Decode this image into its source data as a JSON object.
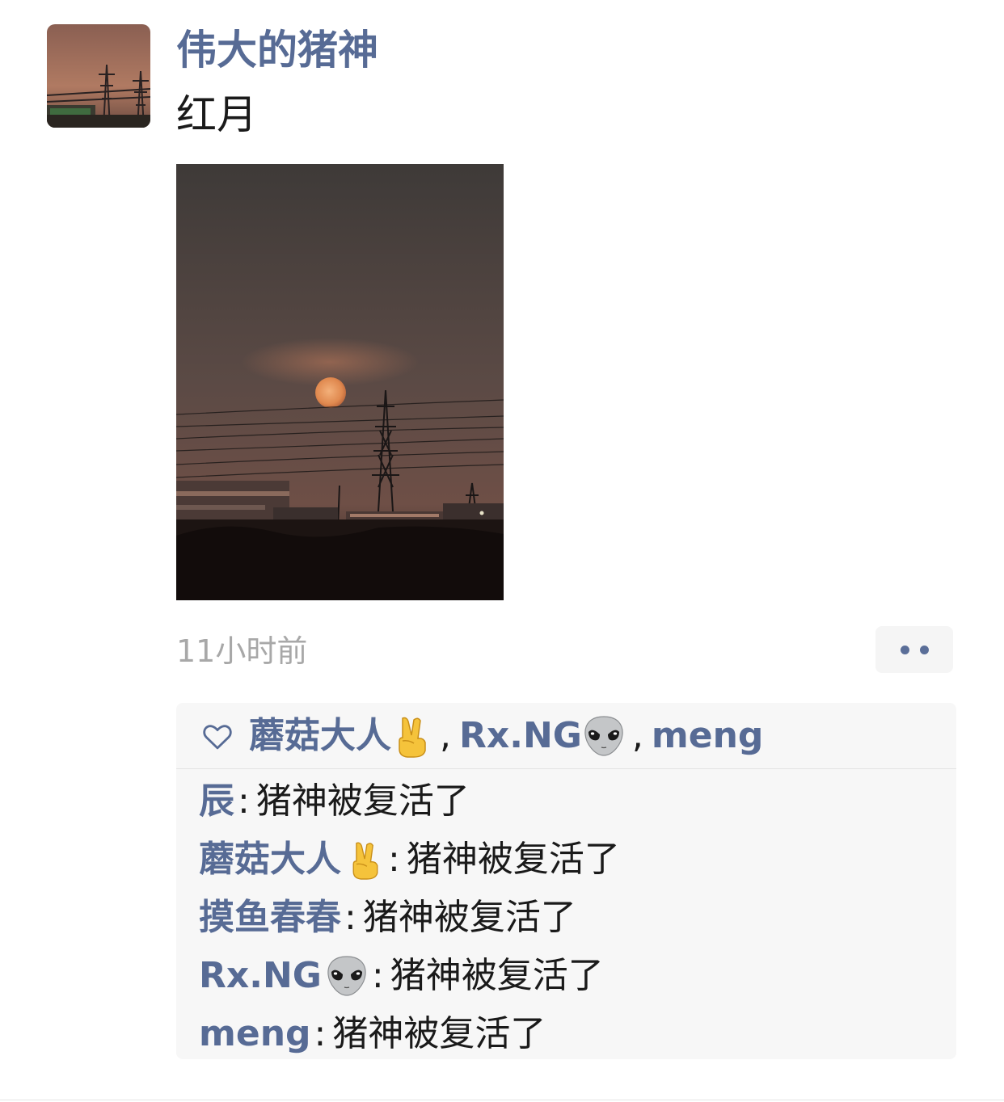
{
  "post": {
    "author": "伟大的猪神",
    "text": "红月",
    "time": "11小时前"
  },
  "icons": {
    "avatar": "avatar-image",
    "photo": "red-moon-photo",
    "more": "more-dots-icon",
    "like": "heart-outline-icon",
    "emoji_victory": "victory-hand-emoji",
    "emoji_alien": "alien-emoji"
  },
  "likes": {
    "separator": ",",
    "users": [
      "蘑菇大人",
      "Rx.NG",
      "meng"
    ]
  },
  "comments": {
    "colon": ":",
    "items": [
      {
        "author": "辰",
        "text": "猪神被复活了"
      },
      {
        "author": "蘑菇大人",
        "text": "猪神被复活了"
      },
      {
        "author": "摸鱼春春",
        "text": "猪神被复活了"
      },
      {
        "author": "Rx.NG",
        "text": "猪神被复活了"
      },
      {
        "author": "meng",
        "text": "猪神被复活了"
      }
    ]
  },
  "colors": {
    "name_blue": "#576b95",
    "time_gray": "#a8a8a8",
    "panel_bg": "#f7f7f7"
  }
}
